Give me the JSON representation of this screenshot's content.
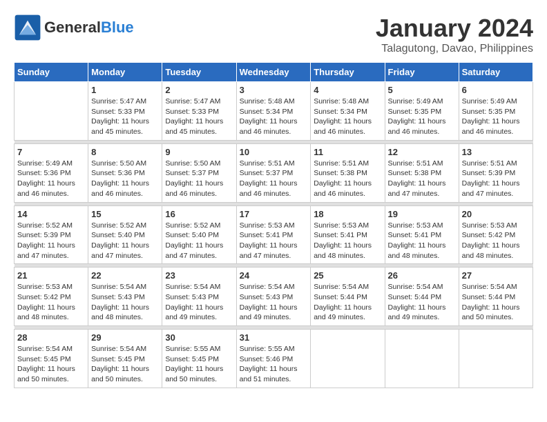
{
  "logo": {
    "line1": "General",
    "line2": "Blue"
  },
  "title": "January 2024",
  "subtitle": "Talagutong, Davao, Philippines",
  "columns": [
    "Sunday",
    "Monday",
    "Tuesday",
    "Wednesday",
    "Thursday",
    "Friday",
    "Saturday"
  ],
  "weeks": [
    [
      {
        "day": "",
        "info": ""
      },
      {
        "day": "1",
        "info": "Sunrise: 5:47 AM\nSunset: 5:33 PM\nDaylight: 11 hours\nand 45 minutes."
      },
      {
        "day": "2",
        "info": "Sunrise: 5:47 AM\nSunset: 5:33 PM\nDaylight: 11 hours\nand 45 minutes."
      },
      {
        "day": "3",
        "info": "Sunrise: 5:48 AM\nSunset: 5:34 PM\nDaylight: 11 hours\nand 46 minutes."
      },
      {
        "day": "4",
        "info": "Sunrise: 5:48 AM\nSunset: 5:34 PM\nDaylight: 11 hours\nand 46 minutes."
      },
      {
        "day": "5",
        "info": "Sunrise: 5:49 AM\nSunset: 5:35 PM\nDaylight: 11 hours\nand 46 minutes."
      },
      {
        "day": "6",
        "info": "Sunrise: 5:49 AM\nSunset: 5:35 PM\nDaylight: 11 hours\nand 46 minutes."
      }
    ],
    [
      {
        "day": "7",
        "info": "Sunrise: 5:49 AM\nSunset: 5:36 PM\nDaylight: 11 hours\nand 46 minutes."
      },
      {
        "day": "8",
        "info": "Sunrise: 5:50 AM\nSunset: 5:36 PM\nDaylight: 11 hours\nand 46 minutes."
      },
      {
        "day": "9",
        "info": "Sunrise: 5:50 AM\nSunset: 5:37 PM\nDaylight: 11 hours\nand 46 minutes."
      },
      {
        "day": "10",
        "info": "Sunrise: 5:51 AM\nSunset: 5:37 PM\nDaylight: 11 hours\nand 46 minutes."
      },
      {
        "day": "11",
        "info": "Sunrise: 5:51 AM\nSunset: 5:38 PM\nDaylight: 11 hours\nand 46 minutes."
      },
      {
        "day": "12",
        "info": "Sunrise: 5:51 AM\nSunset: 5:38 PM\nDaylight: 11 hours\nand 47 minutes."
      },
      {
        "day": "13",
        "info": "Sunrise: 5:51 AM\nSunset: 5:39 PM\nDaylight: 11 hours\nand 47 minutes."
      }
    ],
    [
      {
        "day": "14",
        "info": "Sunrise: 5:52 AM\nSunset: 5:39 PM\nDaylight: 11 hours\nand 47 minutes."
      },
      {
        "day": "15",
        "info": "Sunrise: 5:52 AM\nSunset: 5:40 PM\nDaylight: 11 hours\nand 47 minutes."
      },
      {
        "day": "16",
        "info": "Sunrise: 5:52 AM\nSunset: 5:40 PM\nDaylight: 11 hours\nand 47 minutes."
      },
      {
        "day": "17",
        "info": "Sunrise: 5:53 AM\nSunset: 5:41 PM\nDaylight: 11 hours\nand 47 minutes."
      },
      {
        "day": "18",
        "info": "Sunrise: 5:53 AM\nSunset: 5:41 PM\nDaylight: 11 hours\nand 48 minutes."
      },
      {
        "day": "19",
        "info": "Sunrise: 5:53 AM\nSunset: 5:41 PM\nDaylight: 11 hours\nand 48 minutes."
      },
      {
        "day": "20",
        "info": "Sunrise: 5:53 AM\nSunset: 5:42 PM\nDaylight: 11 hours\nand 48 minutes."
      }
    ],
    [
      {
        "day": "21",
        "info": "Sunrise: 5:53 AM\nSunset: 5:42 PM\nDaylight: 11 hours\nand 48 minutes."
      },
      {
        "day": "22",
        "info": "Sunrise: 5:54 AM\nSunset: 5:43 PM\nDaylight: 11 hours\nand 48 minutes."
      },
      {
        "day": "23",
        "info": "Sunrise: 5:54 AM\nSunset: 5:43 PM\nDaylight: 11 hours\nand 49 minutes."
      },
      {
        "day": "24",
        "info": "Sunrise: 5:54 AM\nSunset: 5:43 PM\nDaylight: 11 hours\nand 49 minutes."
      },
      {
        "day": "25",
        "info": "Sunrise: 5:54 AM\nSunset: 5:44 PM\nDaylight: 11 hours\nand 49 minutes."
      },
      {
        "day": "26",
        "info": "Sunrise: 5:54 AM\nSunset: 5:44 PM\nDaylight: 11 hours\nand 49 minutes."
      },
      {
        "day": "27",
        "info": "Sunrise: 5:54 AM\nSunset: 5:44 PM\nDaylight: 11 hours\nand 50 minutes."
      }
    ],
    [
      {
        "day": "28",
        "info": "Sunrise: 5:54 AM\nSunset: 5:45 PM\nDaylight: 11 hours\nand 50 minutes."
      },
      {
        "day": "29",
        "info": "Sunrise: 5:54 AM\nSunset: 5:45 PM\nDaylight: 11 hours\nand 50 minutes."
      },
      {
        "day": "30",
        "info": "Sunrise: 5:55 AM\nSunset: 5:45 PM\nDaylight: 11 hours\nand 50 minutes."
      },
      {
        "day": "31",
        "info": "Sunrise: 5:55 AM\nSunset: 5:46 PM\nDaylight: 11 hours\nand 51 minutes."
      },
      {
        "day": "",
        "info": ""
      },
      {
        "day": "",
        "info": ""
      },
      {
        "day": "",
        "info": ""
      }
    ]
  ]
}
